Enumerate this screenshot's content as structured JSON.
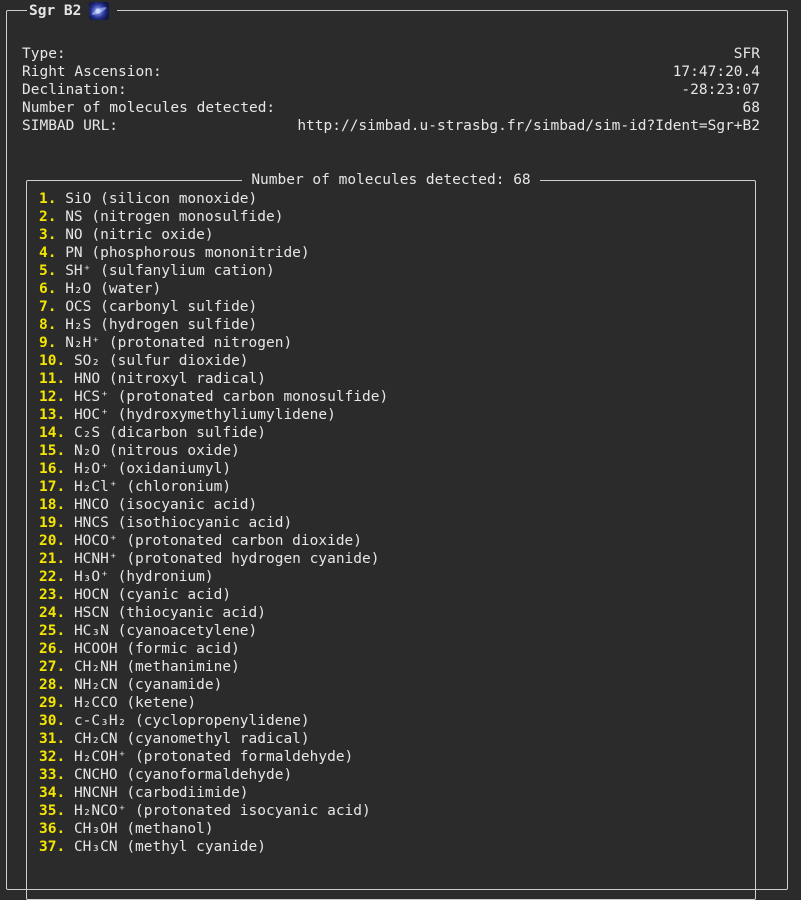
{
  "panel": {
    "title": "Sgr B2",
    "icon": "galaxy-icon"
  },
  "info": [
    {
      "label": "Type:",
      "value": "SFR"
    },
    {
      "label": "Right Ascension:",
      "value": "17:47:20.4"
    },
    {
      "label": "Declination:",
      "value": "-28:23:07"
    },
    {
      "label": "Number of molecules detected:",
      "value": "68"
    },
    {
      "label": "SIMBAD URL:",
      "value": "http://simbad.u-strasbg.fr/simbad/sim-id?Ident=Sgr+B2"
    }
  ],
  "molecules_panel": {
    "title": "Number of molecules detected: 68"
  },
  "molecules": [
    {
      "num": "1.",
      "name": "SiO (silicon monoxide)"
    },
    {
      "num": "2.",
      "name": "NS (nitrogen monosulfide)"
    },
    {
      "num": "3.",
      "name": "NO (nitric oxide)"
    },
    {
      "num": "4.",
      "name": "PN (phosphorous mononitride)"
    },
    {
      "num": "5.",
      "name": "SH⁺ (sulfanylium cation)"
    },
    {
      "num": "6.",
      "name": "H₂O (water)"
    },
    {
      "num": "7.",
      "name": "OCS (carbonyl sulfide)"
    },
    {
      "num": "8.",
      "name": "H₂S (hydrogen sulfide)"
    },
    {
      "num": "9.",
      "name": "N₂H⁺ (protonated nitrogen)"
    },
    {
      "num": "10.",
      "name": "SO₂ (sulfur dioxide)"
    },
    {
      "num": "11.",
      "name": "HNO (nitroxyl radical)"
    },
    {
      "num": "12.",
      "name": "HCS⁺ (protonated carbon monosulfide)"
    },
    {
      "num": "13.",
      "name": "HOC⁺ (hydroxymethyliumylidene)"
    },
    {
      "num": "14.",
      "name": "C₂S (dicarbon sulfide)"
    },
    {
      "num": "15.",
      "name": "N₂O (nitrous oxide)"
    },
    {
      "num": "16.",
      "name": "H₂O⁺ (oxidaniumyl)"
    },
    {
      "num": "17.",
      "name": "H₂Cl⁺ (chloronium)"
    },
    {
      "num": "18.",
      "name": "HNCO (isocyanic acid)"
    },
    {
      "num": "19.",
      "name": "HNCS (isothiocyanic acid)"
    },
    {
      "num": "20.",
      "name": "HOCO⁺ (protonated carbon dioxide)"
    },
    {
      "num": "21.",
      "name": "HCNH⁺ (protonated hydrogen cyanide)"
    },
    {
      "num": "22.",
      "name": "H₃O⁺ (hydronium)"
    },
    {
      "num": "23.",
      "name": "HOCN (cyanic acid)"
    },
    {
      "num": "24.",
      "name": "HSCN (thiocyanic acid)"
    },
    {
      "num": "25.",
      "name": "HC₃N (cyanoacetylene)"
    },
    {
      "num": "26.",
      "name": "HCOOH (formic acid)"
    },
    {
      "num": "27.",
      "name": "CH₂NH (methanimine)"
    },
    {
      "num": "28.",
      "name": "NH₂CN (cyanamide)"
    },
    {
      "num": "29.",
      "name": "H₂CCO (ketene)"
    },
    {
      "num": "30.",
      "name": "c-C₃H₂ (cyclopropenylidene)"
    },
    {
      "num": "31.",
      "name": "CH₂CN (cyanomethyl radical)"
    },
    {
      "num": "32.",
      "name": "H₂COH⁺ (protonated formaldehyde)"
    },
    {
      "num": "33.",
      "name": "CNCHO (cyanoformaldehyde)"
    },
    {
      "num": "34.",
      "name": "HNCNH (carbodiimide)"
    },
    {
      "num": "35.",
      "name": "H₂NCO⁺ (protonated isocyanic acid)"
    },
    {
      "num": "36.",
      "name": "CH₃OH (methanol)"
    },
    {
      "num": "37.",
      "name": "CH₃CN (methyl cyanide)"
    }
  ]
}
